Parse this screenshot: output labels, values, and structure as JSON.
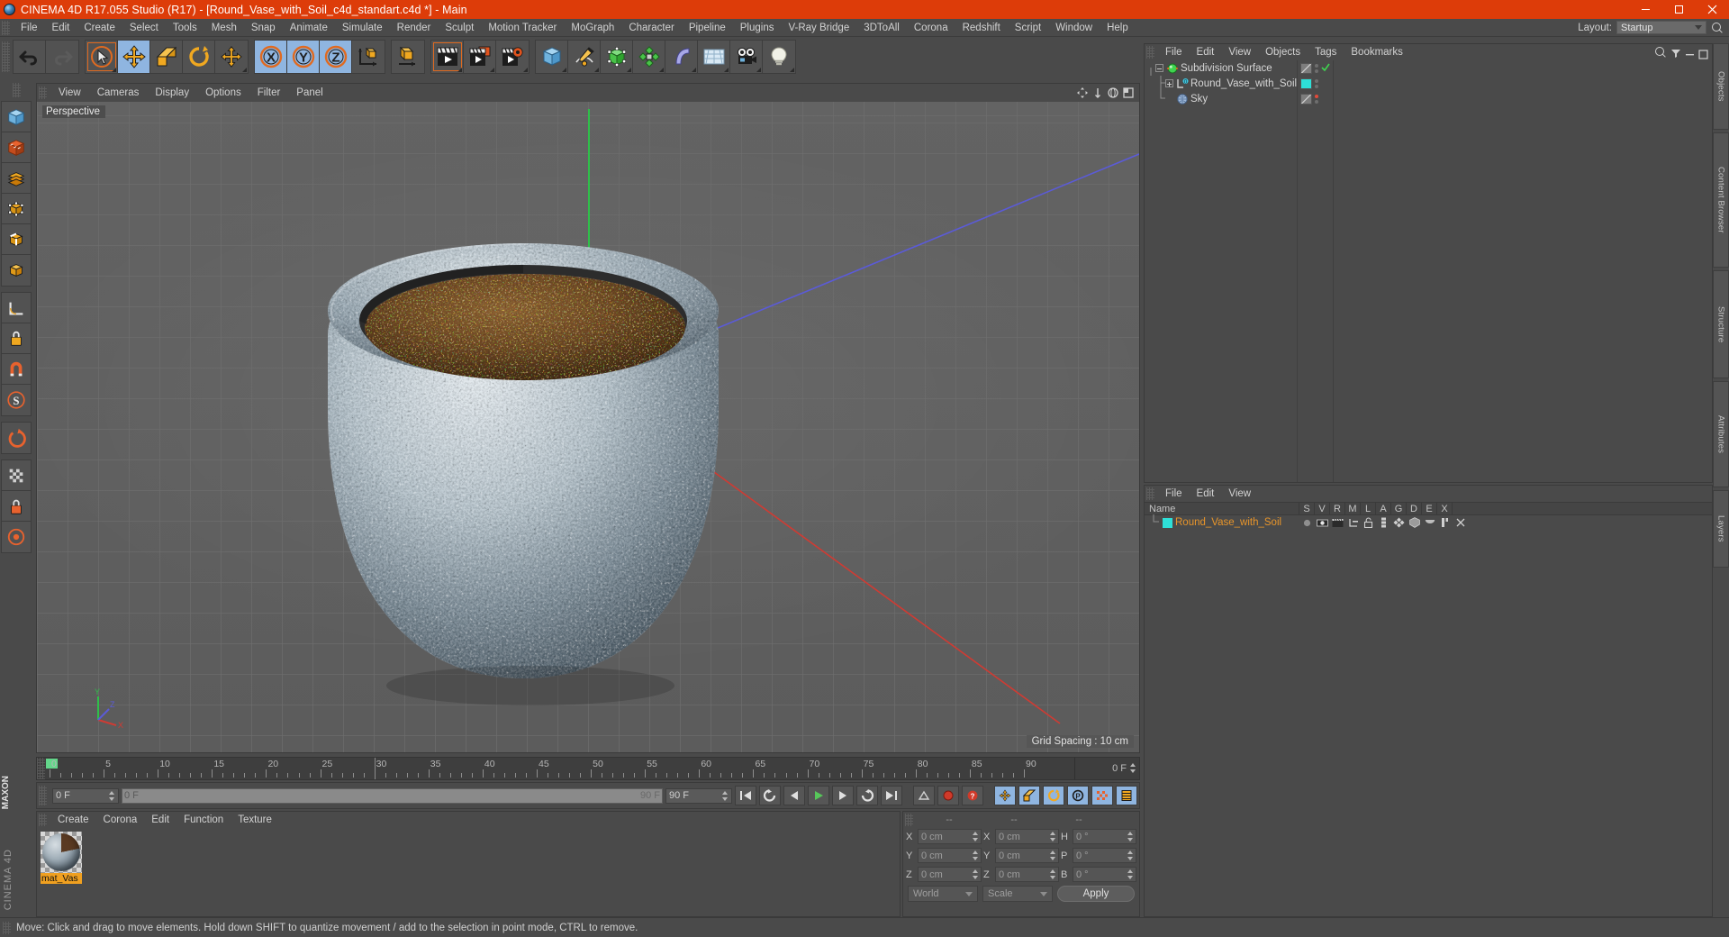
{
  "window": {
    "title": "CINEMA 4D R17.055 Studio (R17) - [Round_Vase_with_Soil_c4d_standart.c4d *] - Main",
    "app_icon": "c4d-logo-icon",
    "minimize": "minimize-icon",
    "maximize": "maximize-icon",
    "close": "close-icon",
    "title_bar_color": "#dd3c09"
  },
  "menubar": {
    "items": [
      "File",
      "Edit",
      "Create",
      "Select",
      "Tools",
      "Mesh",
      "Snap",
      "Animate",
      "Simulate",
      "Render",
      "Sculpt",
      "Motion Tracker",
      "MoGraph",
      "Character",
      "Pipeline",
      "Plugins",
      "V-Ray Bridge",
      "3DToAll",
      "Corona",
      "Redshift",
      "Script",
      "Window",
      "Help"
    ],
    "layout_label": "Layout:",
    "layout_value": "Startup",
    "search_icon": "magnifier-icon"
  },
  "toolbar": {
    "groups": [
      {
        "buttons": [
          {
            "name": "undo-button",
            "icon": "undo-arrow-icon",
            "state": "normal"
          },
          {
            "name": "redo-button",
            "icon": "redo-arrow-icon",
            "state": "disabled"
          }
        ]
      },
      {
        "buttons": [
          {
            "name": "live-selection-tool",
            "icon": "cursor-circle-icon",
            "state": "highlight"
          },
          {
            "name": "move-tool",
            "icon": "move-cross-icon",
            "state": "active"
          },
          {
            "name": "scale-tool",
            "icon": "scale-box-icon",
            "state": "normal"
          },
          {
            "name": "rotate-tool",
            "icon": "rotate-circle-icon",
            "state": "normal"
          },
          {
            "name": "transform-tool",
            "icon": "move-cross-icon",
            "state": "normal"
          }
        ]
      },
      {
        "buttons": [
          {
            "name": "x-axis-lock",
            "icon": "x-axis-icon",
            "state": "active",
            "label": "X"
          },
          {
            "name": "y-axis-lock",
            "icon": "y-axis-icon",
            "state": "active",
            "label": "Y"
          },
          {
            "name": "z-axis-lock",
            "icon": "z-axis-icon",
            "state": "active",
            "label": "Z"
          },
          {
            "name": "world-object-coord-toggle",
            "icon": "world-axis-icon",
            "state": "normal"
          }
        ]
      },
      {
        "buttons": [
          {
            "name": "object-axis-toggle",
            "icon": "object-cube-icon",
            "state": "normal"
          }
        ]
      },
      {
        "buttons": [
          {
            "name": "render-view-button",
            "icon": "clapper-render-icon",
            "state": "highlight"
          },
          {
            "name": "render-to-picture-viewer-button",
            "icon": "clapper-picture-icon",
            "state": "normal"
          },
          {
            "name": "render-settings-button",
            "icon": "clapper-gear-icon",
            "state": "normal"
          }
        ]
      },
      {
        "buttons": [
          {
            "name": "add-cube-button",
            "icon": "cube-blue-icon",
            "state": "normal"
          },
          {
            "name": "add-spline-button",
            "icon": "pen-spline-icon",
            "state": "normal"
          },
          {
            "name": "add-nurbs-button",
            "icon": "green-nurbs-icon",
            "state": "normal"
          },
          {
            "name": "add-modeling-object-button",
            "icon": "green-array-icon",
            "state": "normal"
          },
          {
            "name": "add-deformer-button",
            "icon": "bend-deformer-icon",
            "state": "normal"
          },
          {
            "name": "add-environment-button",
            "icon": "floor-grid-icon",
            "state": "normal"
          },
          {
            "name": "add-camera-button",
            "icon": "camera-icon",
            "state": "normal"
          },
          {
            "name": "add-light-button",
            "icon": "light-bulb-icon",
            "state": "normal"
          }
        ]
      }
    ]
  },
  "left_toolbar": {
    "groups": [
      {
        "buttons": [
          {
            "name": "model-mode-button",
            "icon": "model-cube-icon"
          },
          {
            "name": "texture-mode-button",
            "icon": "texture-checker-icon"
          },
          {
            "name": "polygon-mode-button",
            "icon": "polygon-stack-icon"
          },
          {
            "name": "point-mode-button",
            "icon": "point-cube-icon"
          },
          {
            "name": "edge-mode-button",
            "icon": "edge-cube-icon"
          },
          {
            "name": "object-mode-button",
            "icon": "object-cube-orange-icon"
          }
        ]
      },
      {
        "buttons": [
          {
            "name": "measure-tool-button",
            "icon": "ruler-angle-icon"
          },
          {
            "name": "workplane-lock-button",
            "icon": "workplane-lock-icon"
          },
          {
            "name": "snap-button",
            "icon": "magnet-icon"
          },
          {
            "name": "sculpt-symmetry-button",
            "icon": "s-symmetry-icon"
          }
        ]
      },
      {
        "buttons": [
          {
            "name": "enable-axis-button",
            "icon": "axis-modify-icon"
          }
        ]
      },
      {
        "buttons": [
          {
            "name": "viewport-solo-button",
            "icon": "checker-grid-icon"
          },
          {
            "name": "lock-selection-button",
            "icon": "padlock-icon"
          },
          {
            "name": "quantize-button",
            "icon": "quantize-circle-icon"
          }
        ]
      }
    ]
  },
  "brand": {
    "maxon": "MAXON",
    "product": "CINEMA 4D"
  },
  "viewport": {
    "menu": [
      "View",
      "Cameras",
      "Display",
      "Options",
      "Filter",
      "Panel"
    ],
    "view_label": "Perspective",
    "grid_spacing": "Grid Spacing : 10 cm",
    "nav_icons": [
      "pan-icon",
      "zoom-icon",
      "rotate-view-icon",
      "maximize-view-icon"
    ],
    "axis_gizmo": {
      "x": "X",
      "y": "Y",
      "z": "Z"
    },
    "scene_description": "Round stone vase filled with brown soil, perspective view"
  },
  "object_manager": {
    "menu": [
      "File",
      "Edit",
      "View",
      "Objects",
      "Tags",
      "Bookmarks"
    ],
    "tools": [
      "search-icon",
      "filter-icon",
      "minimize-panel-icon",
      "expand-panel-icon"
    ],
    "rows": [
      {
        "name": "Subdivision Surface",
        "icon": "subdivision-surface-icon",
        "depth": 0,
        "expander": "minus",
        "tag_swatch": "diagonal",
        "dots": [
          "normal",
          "normal"
        ],
        "check": true
      },
      {
        "name": "Round_Vase_with_Soil",
        "icon": "polygon-object-icon",
        "depth": 1,
        "expander": "plus",
        "tag_swatch": "cyan",
        "dots": [
          "normal",
          "normal"
        ],
        "check": false
      },
      {
        "name": "Sky",
        "icon": "sky-sphere-icon",
        "depth": 1,
        "expander": "none",
        "tag_swatch": "diagonal",
        "dots": [
          "red",
          "normal"
        ],
        "check": false
      }
    ]
  },
  "layer_manager": {
    "menu": [
      "File",
      "Edit",
      "View"
    ],
    "columns": [
      "Name",
      "S",
      "V",
      "R",
      "M",
      "L",
      "A",
      "G",
      "D",
      "E",
      "X"
    ],
    "rows": [
      {
        "name": "Round_Vase_with_Soil",
        "swatch_color": "#2ee0d8",
        "icons": [
          "dot-gray-icon",
          "eye-icon",
          "render-clapper-icon",
          "manager-icon",
          "unlock-icon",
          "layer-stack-icon",
          "axis-icon",
          "generator-icon",
          "deformer-icon",
          "expression-icon",
          "xref-icon"
        ]
      }
    ]
  },
  "timeline": {
    "tick_labels": [
      "0",
      "5",
      "10",
      "15",
      "20",
      "25",
      "30",
      "35",
      "40",
      "45",
      "50",
      "55",
      "60",
      "65",
      "70",
      "75",
      "80",
      "85",
      "90"
    ],
    "tick_values": [
      0,
      5,
      10,
      15,
      20,
      25,
      30,
      35,
      40,
      45,
      50,
      55,
      60,
      65,
      70,
      75,
      80,
      85,
      90
    ],
    "current_frame_label": "0 F",
    "end_frame_label": "90 F",
    "playhead_frame": 0
  },
  "playbar": {
    "current_frame": "0 F",
    "range_start": "0 F",
    "range_end": "90 F",
    "max_frame": "90 F",
    "buttons": [
      {
        "name": "go-to-start-button",
        "icon": "skip-start-icon"
      },
      {
        "name": "play-reverse-loop-button",
        "icon": "loop-reverse-icon"
      },
      {
        "name": "step-back-button",
        "icon": "step-back-icon"
      },
      {
        "name": "play-button",
        "icon": "play-icon"
      },
      {
        "name": "step-forward-button",
        "icon": "step-forward-icon"
      },
      {
        "name": "loop-button",
        "icon": "loop-icon"
      },
      {
        "name": "go-to-end-button",
        "icon": "skip-end-icon"
      },
      {
        "name": "autokeying-button",
        "icon": "key-autokey-icon"
      },
      {
        "name": "record-button",
        "icon": "record-dot-icon"
      },
      {
        "name": "keyframe-selection-button",
        "icon": "key-question-icon"
      },
      {
        "name": "record-position-button",
        "icon": "position-key-icon"
      },
      {
        "name": "record-scale-button",
        "icon": "scale-key-icon"
      },
      {
        "name": "record-rotation-button",
        "icon": "rotation-key-icon"
      },
      {
        "name": "record-param-button",
        "icon": "param-key-icon"
      },
      {
        "name": "record-pla-button",
        "icon": "pla-key-icon"
      },
      {
        "name": "keyframe-mode-button",
        "icon": "keyframe-mode-icon"
      }
    ]
  },
  "material_manager": {
    "menu": [
      "Create",
      "Corona",
      "Edit",
      "Function",
      "Texture"
    ],
    "materials": [
      {
        "name": "mat_Vas",
        "preview": "stone-soil-sphere-preview"
      }
    ]
  },
  "coordinates": {
    "header_dashes": [
      "--",
      "--",
      "--"
    ],
    "rows": [
      {
        "label_pos": "X",
        "value_pos": "0 cm",
        "label_size": "X",
        "value_size": "0 cm",
        "label_rot": "H",
        "value_rot": "0 °"
      },
      {
        "label_pos": "Y",
        "value_pos": "0 cm",
        "label_size": "Y",
        "value_size": "0 cm",
        "label_rot": "P",
        "value_rot": "0 °"
      },
      {
        "label_pos": "Z",
        "value_pos": "0 cm",
        "label_size": "Z",
        "value_size": "0 cm",
        "label_rot": "B",
        "value_rot": "0 °"
      }
    ],
    "system_select": "World",
    "mode_select": "Scale",
    "apply_label": "Apply"
  },
  "right_tabs": [
    "Objects",
    "Content Browser",
    "Structure",
    "Attributes",
    "Layers"
  ],
  "status_bar": {
    "text": "Move: Click and drag to move elements. Hold down SHIFT to quantize movement / add to the selection in point mode, CTRL to remove."
  },
  "colors": {
    "accent_orange": "#dd3c09",
    "panel_gray": "#4a4a4a",
    "active_blue": "#8fb5e0",
    "material_label": "#f0a020",
    "cyan_swatch": "#2ee0d8"
  }
}
